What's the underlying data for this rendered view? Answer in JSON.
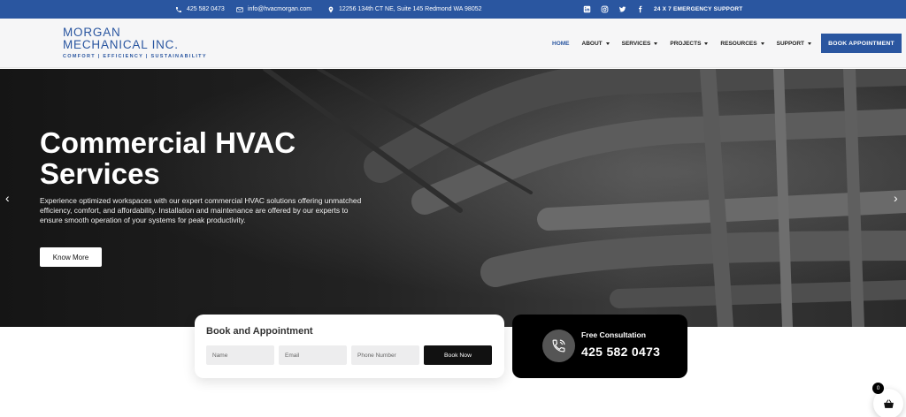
{
  "topbar": {
    "phone": "425 582 0473",
    "email": "info@hvacmorgan.com",
    "address": "12256 134th CT NE, Suite 145 Redmond WA 98052",
    "emergency": "24 X 7 EMERGENCY SUPPORT",
    "social_icons": [
      "linkedin-icon",
      "instagram-icon",
      "twitter-icon",
      "facebook-icon"
    ]
  },
  "header": {
    "logo_line1": "MORGAN",
    "logo_line2": "MECHANICAL INC.",
    "logo_tagline": "COMFORT | EFFICIENCY | SUSTAINABILITY",
    "nav": [
      {
        "label": "HOME"
      },
      {
        "label": "ABOUT"
      },
      {
        "label": "SERVICES"
      },
      {
        "label": "PROJECTS"
      },
      {
        "label": "RESOURCES"
      },
      {
        "label": "SUPPORT"
      }
    ],
    "cta": "BOOK APPOINTMENT"
  },
  "hero": {
    "title": "Commercial HVAC Services",
    "text": "Experience optimized workspaces with our expert commercial HVAC solutions offering unmatched efficiency, comfort, and affordability. Installation and maintenance are offered by our experts to ensure smooth operation of your systems for peak productivity.",
    "button": "Know More",
    "prev": "‹",
    "next": "›"
  },
  "booking": {
    "title": "Book and Appointment",
    "name_placeholder": "Name",
    "email_placeholder": "Email",
    "phone_placeholder": "Phone Number",
    "submit": "Book Now"
  },
  "consult": {
    "title": "Free Consultation",
    "phone": "425 582 0473"
  },
  "cart": {
    "count": "0"
  },
  "colors": {
    "brand_blue": "#2a56a0",
    "dark": "#111111"
  }
}
